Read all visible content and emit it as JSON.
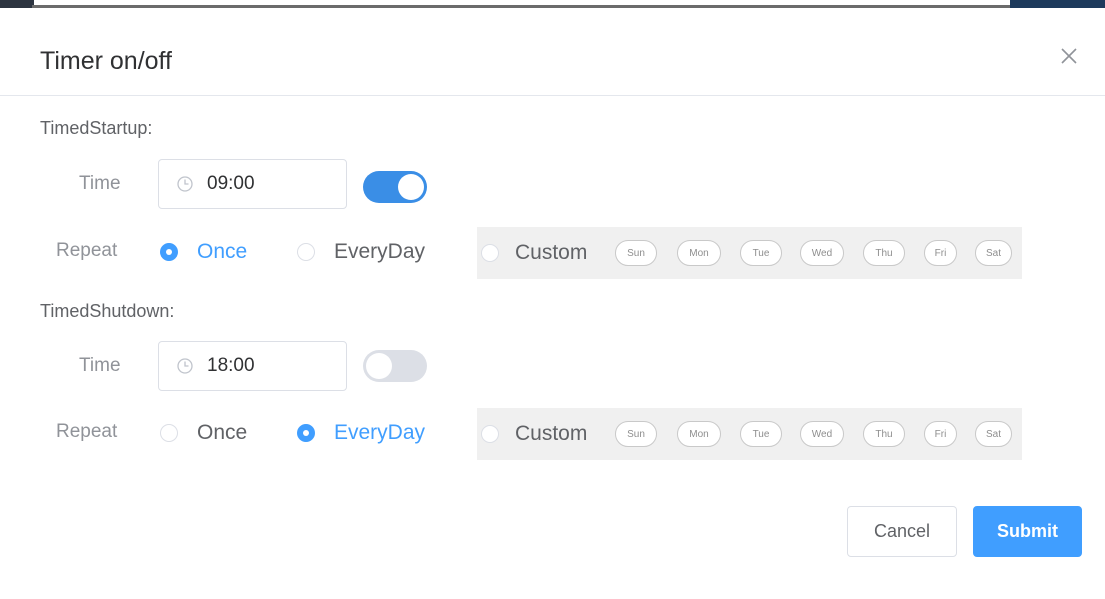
{
  "dialog": {
    "title": "Timer on/off"
  },
  "startup": {
    "section_label": "TimedStartup:",
    "time_label": "Time",
    "time_value": "09:00",
    "switch_on": true,
    "repeat_label": "Repeat",
    "options": {
      "once": "Once",
      "everyday": "EveryDay",
      "custom": "Custom"
    },
    "selected": "once",
    "days": [
      "Sun",
      "Mon",
      "Tue",
      "Wed",
      "Thu",
      "Fri",
      "Sat"
    ]
  },
  "shutdown": {
    "section_label": "TimedShutdown:",
    "time_label": "Time",
    "time_value": "18:00",
    "switch_on": false,
    "repeat_label": "Repeat",
    "options": {
      "once": "Once",
      "everyday": "EveryDay",
      "custom": "Custom"
    },
    "selected": "everyday",
    "days": [
      "Sun",
      "Mon",
      "Tue",
      "Wed",
      "Thu",
      "Fri",
      "Sat"
    ]
  },
  "footer": {
    "cancel_label": "Cancel",
    "submit_label": "Submit"
  },
  "colors": {
    "primary": "#409eff",
    "switch_on": "#3a8ee6",
    "switch_off": "#dcdfe6",
    "custom_bg": "#f0f0f0"
  },
  "icons": {
    "close": "close-icon",
    "clock": "clock-icon"
  }
}
